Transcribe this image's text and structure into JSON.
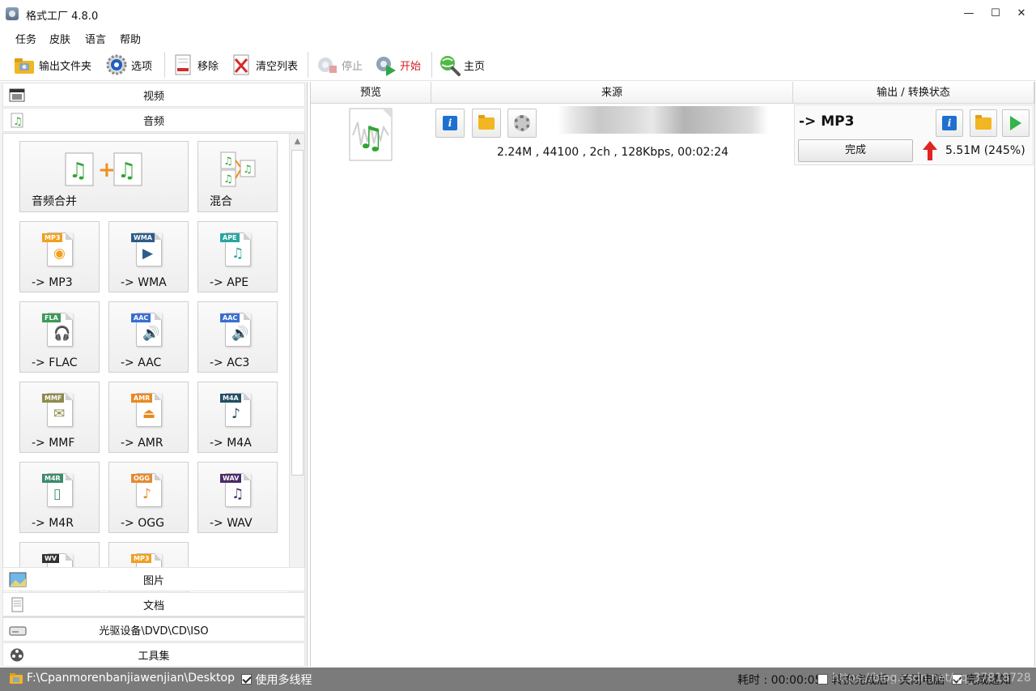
{
  "window": {
    "title": "格式工厂 4.8.0",
    "controls": [
      "—",
      "☐",
      "✕"
    ]
  },
  "menu": [
    "任务",
    "皮肤",
    "语言",
    "帮助"
  ],
  "toolbar": {
    "output_folder": "输出文件夹",
    "options": "选项",
    "remove": "移除",
    "clear_list": "清空列表",
    "stop": "停止",
    "start": "开始",
    "home": "主页"
  },
  "categories": {
    "video": "视频",
    "audio": "音频",
    "picture": "图片",
    "document": "文档",
    "disc": "光驱设备\\DVD\\CD\\ISO",
    "tools": "工具集"
  },
  "audio_tiles": [
    {
      "label": "音频合并",
      "icon": "audio-merge-icon",
      "wide": true
    },
    {
      "label": "混合",
      "icon": "audio-mix-icon"
    },
    {
      "label": "-> MP3",
      "badge": "MP3",
      "badge_color": "#f0a020",
      "glyph": "◉",
      "icon": "speaker-icon"
    },
    {
      "label": "-> WMA",
      "badge": "WMA",
      "badge_color": "#2d5b8a",
      "glyph": "▶",
      "icon": "media-play-icon"
    },
    {
      "label": "-> APE",
      "badge": "APE",
      "badge_color": "#2aa5a0",
      "glyph": "♫",
      "icon": "music-cd-icon"
    },
    {
      "label": "-> FLAC",
      "badge": "FLA",
      "badge_color": "#3c9a5a",
      "glyph": "🎧",
      "icon": "headphones-icon"
    },
    {
      "label": "-> AAC",
      "badge": "AAC",
      "badge_color": "#3a6fd0",
      "glyph": "🔊",
      "icon": "speaker-icon"
    },
    {
      "label": "-> AC3",
      "badge": "AAC",
      "badge_color": "#3a6fd0",
      "glyph": "🔊",
      "icon": "speaker-icon"
    },
    {
      "label": "-> MMF",
      "badge": "MMF",
      "badge_color": "#8c8a4c",
      "glyph": "✉",
      "icon": "mail-icon"
    },
    {
      "label": "-> AMR",
      "badge": "AMR",
      "badge_color": "#e68a20",
      "glyph": "⏏",
      "icon": "device-icon"
    },
    {
      "label": "-> M4A",
      "badge": "M4A",
      "badge_color": "#1f4f63",
      "glyph": "♪",
      "icon": "note-cd-icon"
    },
    {
      "label": "-> M4R",
      "badge": "M4R",
      "badge_color": "#3c8a6a",
      "glyph": "▯",
      "icon": "phone-icon"
    },
    {
      "label": "-> OGG",
      "badge": "OGG",
      "badge_color": "#e58a30",
      "glyph": "♪",
      "icon": "note-icon"
    },
    {
      "label": "-> WAV",
      "badge": "WAV",
      "badge_color": "#4a2a6a",
      "glyph": "♫",
      "icon": "notes-icon"
    },
    {
      "label": "",
      "badge": "WV",
      "badge_color": "#333333",
      "glyph": "",
      "icon": "wv-file-icon"
    },
    {
      "label": "",
      "badge": "MP3",
      "badge_color": "#f0a020",
      "glyph": "",
      "icon": "mp3-file-icon"
    }
  ],
  "columns": {
    "preview": "预览",
    "source": "来源",
    "output_status": "输出 / 转换状态"
  },
  "task": {
    "file_meta": "2.24M , 44100 , 2ch , 128Kbps, 00:02:24",
    "output_format": "-> MP3",
    "status_button": "完成",
    "output_size": "5.51M  (245%)"
  },
  "statusbar": {
    "path": "F:\\Cpanmorenbanjiawenjian\\Desktop",
    "multithread": "使用多线程",
    "elapsed": "耗时 : 00:00:05",
    "shutdown": "转换完成后 : 关闭电脑",
    "notify": "完成通知",
    "watermark": "https://blog.csdn.net/qq_37818728"
  },
  "colors": {
    "statusbar_bg": "#7b7b7b",
    "start_text": "#d42020",
    "upload_arrow": "#e02424"
  }
}
